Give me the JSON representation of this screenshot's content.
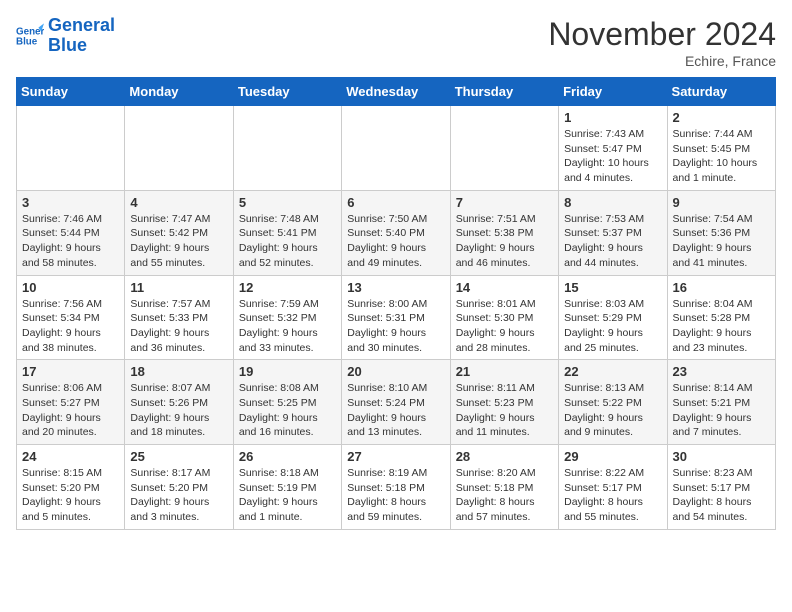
{
  "header": {
    "logo_line1": "General",
    "logo_line2": "Blue",
    "month": "November 2024",
    "location": "Echire, France"
  },
  "days_of_week": [
    "Sunday",
    "Monday",
    "Tuesday",
    "Wednesday",
    "Thursday",
    "Friday",
    "Saturday"
  ],
  "weeks": [
    [
      {
        "day": "",
        "info": ""
      },
      {
        "day": "",
        "info": ""
      },
      {
        "day": "",
        "info": ""
      },
      {
        "day": "",
        "info": ""
      },
      {
        "day": "",
        "info": ""
      },
      {
        "day": "1",
        "info": "Sunrise: 7:43 AM\nSunset: 5:47 PM\nDaylight: 10 hours and 4 minutes."
      },
      {
        "day": "2",
        "info": "Sunrise: 7:44 AM\nSunset: 5:45 PM\nDaylight: 10 hours and 1 minute."
      }
    ],
    [
      {
        "day": "3",
        "info": "Sunrise: 7:46 AM\nSunset: 5:44 PM\nDaylight: 9 hours and 58 minutes."
      },
      {
        "day": "4",
        "info": "Sunrise: 7:47 AM\nSunset: 5:42 PM\nDaylight: 9 hours and 55 minutes."
      },
      {
        "day": "5",
        "info": "Sunrise: 7:48 AM\nSunset: 5:41 PM\nDaylight: 9 hours and 52 minutes."
      },
      {
        "day": "6",
        "info": "Sunrise: 7:50 AM\nSunset: 5:40 PM\nDaylight: 9 hours and 49 minutes."
      },
      {
        "day": "7",
        "info": "Sunrise: 7:51 AM\nSunset: 5:38 PM\nDaylight: 9 hours and 46 minutes."
      },
      {
        "day": "8",
        "info": "Sunrise: 7:53 AM\nSunset: 5:37 PM\nDaylight: 9 hours and 44 minutes."
      },
      {
        "day": "9",
        "info": "Sunrise: 7:54 AM\nSunset: 5:36 PM\nDaylight: 9 hours and 41 minutes."
      }
    ],
    [
      {
        "day": "10",
        "info": "Sunrise: 7:56 AM\nSunset: 5:34 PM\nDaylight: 9 hours and 38 minutes."
      },
      {
        "day": "11",
        "info": "Sunrise: 7:57 AM\nSunset: 5:33 PM\nDaylight: 9 hours and 36 minutes."
      },
      {
        "day": "12",
        "info": "Sunrise: 7:59 AM\nSunset: 5:32 PM\nDaylight: 9 hours and 33 minutes."
      },
      {
        "day": "13",
        "info": "Sunrise: 8:00 AM\nSunset: 5:31 PM\nDaylight: 9 hours and 30 minutes."
      },
      {
        "day": "14",
        "info": "Sunrise: 8:01 AM\nSunset: 5:30 PM\nDaylight: 9 hours and 28 minutes."
      },
      {
        "day": "15",
        "info": "Sunrise: 8:03 AM\nSunset: 5:29 PM\nDaylight: 9 hours and 25 minutes."
      },
      {
        "day": "16",
        "info": "Sunrise: 8:04 AM\nSunset: 5:28 PM\nDaylight: 9 hours and 23 minutes."
      }
    ],
    [
      {
        "day": "17",
        "info": "Sunrise: 8:06 AM\nSunset: 5:27 PM\nDaylight: 9 hours and 20 minutes."
      },
      {
        "day": "18",
        "info": "Sunrise: 8:07 AM\nSunset: 5:26 PM\nDaylight: 9 hours and 18 minutes."
      },
      {
        "day": "19",
        "info": "Sunrise: 8:08 AM\nSunset: 5:25 PM\nDaylight: 9 hours and 16 minutes."
      },
      {
        "day": "20",
        "info": "Sunrise: 8:10 AM\nSunset: 5:24 PM\nDaylight: 9 hours and 13 minutes."
      },
      {
        "day": "21",
        "info": "Sunrise: 8:11 AM\nSunset: 5:23 PM\nDaylight: 9 hours and 11 minutes."
      },
      {
        "day": "22",
        "info": "Sunrise: 8:13 AM\nSunset: 5:22 PM\nDaylight: 9 hours and 9 minutes."
      },
      {
        "day": "23",
        "info": "Sunrise: 8:14 AM\nSunset: 5:21 PM\nDaylight: 9 hours and 7 minutes."
      }
    ],
    [
      {
        "day": "24",
        "info": "Sunrise: 8:15 AM\nSunset: 5:20 PM\nDaylight: 9 hours and 5 minutes."
      },
      {
        "day": "25",
        "info": "Sunrise: 8:17 AM\nSunset: 5:20 PM\nDaylight: 9 hours and 3 minutes."
      },
      {
        "day": "26",
        "info": "Sunrise: 8:18 AM\nSunset: 5:19 PM\nDaylight: 9 hours and 1 minute."
      },
      {
        "day": "27",
        "info": "Sunrise: 8:19 AM\nSunset: 5:18 PM\nDaylight: 8 hours and 59 minutes."
      },
      {
        "day": "28",
        "info": "Sunrise: 8:20 AM\nSunset: 5:18 PM\nDaylight: 8 hours and 57 minutes."
      },
      {
        "day": "29",
        "info": "Sunrise: 8:22 AM\nSunset: 5:17 PM\nDaylight: 8 hours and 55 minutes."
      },
      {
        "day": "30",
        "info": "Sunrise: 8:23 AM\nSunset: 5:17 PM\nDaylight: 8 hours and 54 minutes."
      }
    ]
  ]
}
